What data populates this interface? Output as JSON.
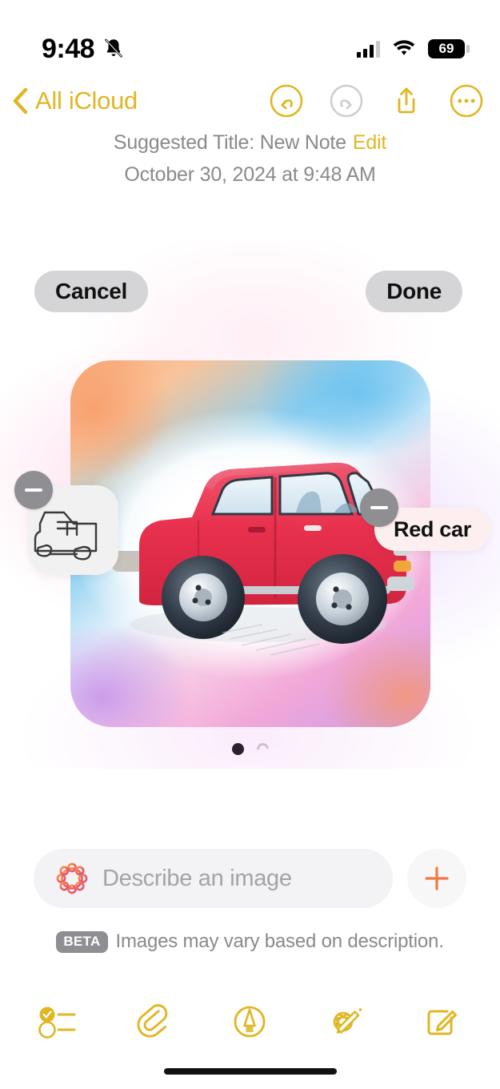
{
  "status_bar": {
    "time": "9:48",
    "silent_icon": "bell-slash-icon",
    "signal_icon": "cellular-signal-icon",
    "wifi_icon": "wifi-icon",
    "battery_level": "69"
  },
  "nav_bar": {
    "back_label": "All iCloud",
    "back_icon": "chevron-left-icon",
    "undo_icon": "undo-circle-icon",
    "redo_icon": "redo-circle-icon",
    "share_icon": "share-up-arrow-icon",
    "more_icon": "ellipsis-circle-icon",
    "accent_color": "#e0b622",
    "disabled_color": "#c9c9cc"
  },
  "note": {
    "suggested_title": "Suggested Title: New Note",
    "edit_label": "Edit",
    "date": "October 30, 2024 at 9:48 AM"
  },
  "playground": {
    "cancel_label": "Cancel",
    "done_label": "Done",
    "concept_chips": [
      {
        "type": "sketch",
        "name": "car-sketch-thumbnail",
        "remove_icon": "minus-circle-icon"
      },
      {
        "type": "text",
        "label": "Red car",
        "remove_icon": "minus-circle-icon"
      }
    ],
    "page_dots": [
      {
        "state": "active"
      },
      {
        "state": "loading"
      }
    ],
    "prompt": {
      "icon": "apple-intelligence-icon",
      "placeholder": "Describe an image",
      "value": "",
      "add_icon": "plus-icon",
      "add_color": "#f07a42"
    },
    "disclaimer": {
      "badge": "BETA",
      "text": "Images may vary based on description."
    },
    "image": {
      "subject": "Red car illustration",
      "style": "sketch illustration with rainbow gradient glow"
    }
  },
  "toolbar": {
    "items": [
      {
        "name": "checklist-icon",
        "label": "Checklist"
      },
      {
        "name": "paperclip-icon",
        "label": "Attachment"
      },
      {
        "name": "markup-pen-icon",
        "label": "Markup"
      },
      {
        "name": "image-playground-icon",
        "label": "Image Playground"
      },
      {
        "name": "compose-icon",
        "label": "New Note"
      }
    ],
    "accent_color": "#e0b622"
  }
}
